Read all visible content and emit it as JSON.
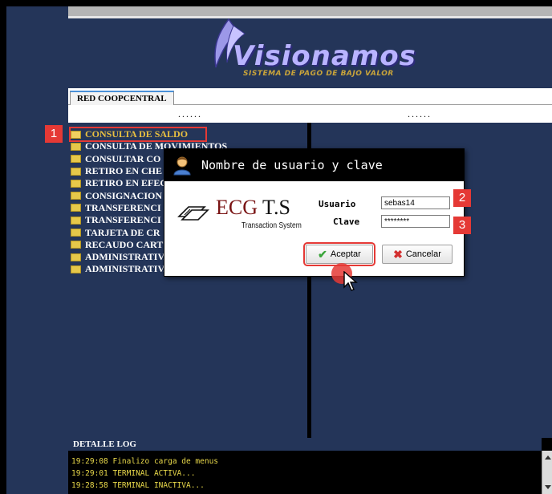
{
  "banner": {
    "logo_text": "Visionamos",
    "logo_subtitle": "SISTEMA DE PAGO DE BAJO VALOR"
  },
  "tabs": [
    {
      "label": "RED COOPCENTRAL",
      "active": true
    }
  ],
  "dots": {
    "left": "......",
    "right": "......"
  },
  "menu": {
    "items": [
      {
        "label": "CONSULTA DE SALDO",
        "selected": true
      },
      {
        "label": "CONSULTA DE MOVIMIENTOS"
      },
      {
        "label": "CONSULTAR CO"
      },
      {
        "label": "RETIRO EN CHE"
      },
      {
        "label": "RETIRO EN EFEC"
      },
      {
        "label": "CONSIGNACION"
      },
      {
        "label": "TRANSFERENCI"
      },
      {
        "label": "TRANSFERENCI"
      },
      {
        "label": "TARJETA DE CR"
      },
      {
        "label": "RECAUDO CART"
      },
      {
        "label": "ADMINISTRATIVAS"
      },
      {
        "label": "ADMINISTRATIVAS - CON TARJETA"
      }
    ]
  },
  "annotations": {
    "badge1": "1",
    "badge2": "2",
    "badge3": "3"
  },
  "dialog": {
    "title": "Nombre de usuario y clave",
    "brand": {
      "ecg": "ECG",
      "ts": "T.S",
      "subtitle": "Transaction System"
    },
    "usuario_label": "Usuario",
    "usuario_value": "sebas14",
    "clave_label": "Clave",
    "clave_value": "********",
    "accept_label": "Aceptar",
    "cancel_label": "Cancelar"
  },
  "log": {
    "header": "DETALLE LOG",
    "lines": [
      "19:29:08 Finalizo carga de menus",
      "19:29:01 TERMINAL ACTIVA...",
      "19:28:58 TERMINAL INACTIVA..."
    ]
  },
  "colors": {
    "panel_bg": "#243559",
    "annotation_red": "#e53935",
    "log_text": "#e8d84a",
    "selected_text": "#e8c040"
  }
}
